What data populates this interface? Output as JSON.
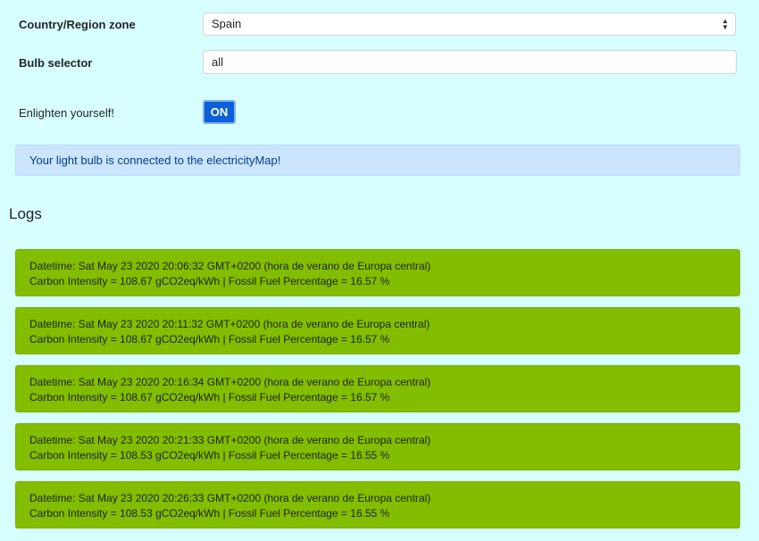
{
  "form": {
    "country_label": "Country/Region zone",
    "country_value": "Spain",
    "bulb_label": "Bulb selector",
    "bulb_value": "all",
    "toggle_label": "Enlighten yourself!",
    "toggle_button": "ON"
  },
  "alert": {
    "message": "Your light bulb is connected to the electricityMap!"
  },
  "logs": {
    "title": "Logs",
    "items": [
      {
        "datetime": "Datetime: Sat May 23 2020 20:06:32 GMT+0200 (hora de verano de Europa central)",
        "details": "Carbon Intensity = 108.67 gCO2eq/kWh | Fossil Fuel Percentage = 16.57 %"
      },
      {
        "datetime": "Datetime: Sat May 23 2020 20:11:32 GMT+0200 (hora de verano de Europa central)",
        "details": "Carbon Intensity = 108.67 gCO2eq/kWh | Fossil Fuel Percentage = 16.57 %"
      },
      {
        "datetime": "Datetime: Sat May 23 2020 20:16:34 GMT+0200 (hora de verano de Europa central)",
        "details": "Carbon Intensity = 108.67 gCO2eq/kWh | Fossil Fuel Percentage = 16.57 %"
      },
      {
        "datetime": "Datetime: Sat May 23 2020 20:21:33 GMT+0200 (hora de verano de Europa central)",
        "details": "Carbon Intensity = 108.53 gCO2eq/kWh | Fossil Fuel Percentage = 16.55 %"
      },
      {
        "datetime": "Datetime: Sat May 23 2020 20:26:33 GMT+0200 (hora de verano de Europa central)",
        "details": "Carbon Intensity = 108.53 gCO2eq/kWh | Fossil Fuel Percentage = 16.55 %"
      }
    ]
  },
  "colors": {
    "page_background": "#d8ffff",
    "toggle_on": "#0c5fd8",
    "alert_background": "#cce5ff",
    "log_background": "#82bd00"
  }
}
